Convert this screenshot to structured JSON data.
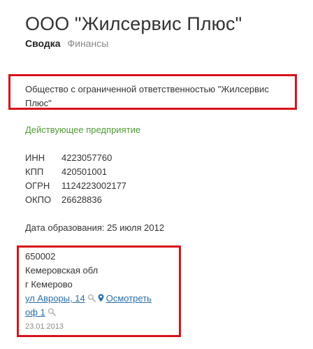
{
  "header": {
    "title": "ООО \"Жилсервис Плюс\"",
    "tabs": [
      {
        "label": "Сводка",
        "active": true
      },
      {
        "label": "Финансы",
        "active": false
      }
    ]
  },
  "company": {
    "full_name": "Общество с ограниченной ответственностью \"Жилсервис Плюс\"",
    "status": "Действующее предприятие",
    "codes": [
      {
        "label": "ИНН",
        "value": "4223057760"
      },
      {
        "label": "КПП",
        "value": "420501001"
      },
      {
        "label": "ОГРН",
        "value": "1124223002177"
      },
      {
        "label": "ОКПО",
        "value": "26628836"
      }
    ],
    "founded": "Дата образования: 25 июля 2012"
  },
  "address": {
    "postal_code": "650002",
    "region": "Кемеровская обл",
    "city": "г Кемерово",
    "street": "ул Авроры, 14",
    "map_link": "Осмотреть",
    "office": "оф 1",
    "date": "23.01.2013"
  },
  "colors": {
    "highlight_border": "#d8121b",
    "link": "#2a6ea8",
    "status_green": "#4f9a35",
    "muted": "#888888"
  },
  "icons": {
    "search": "search-icon",
    "pin": "map-pin-icon"
  }
}
